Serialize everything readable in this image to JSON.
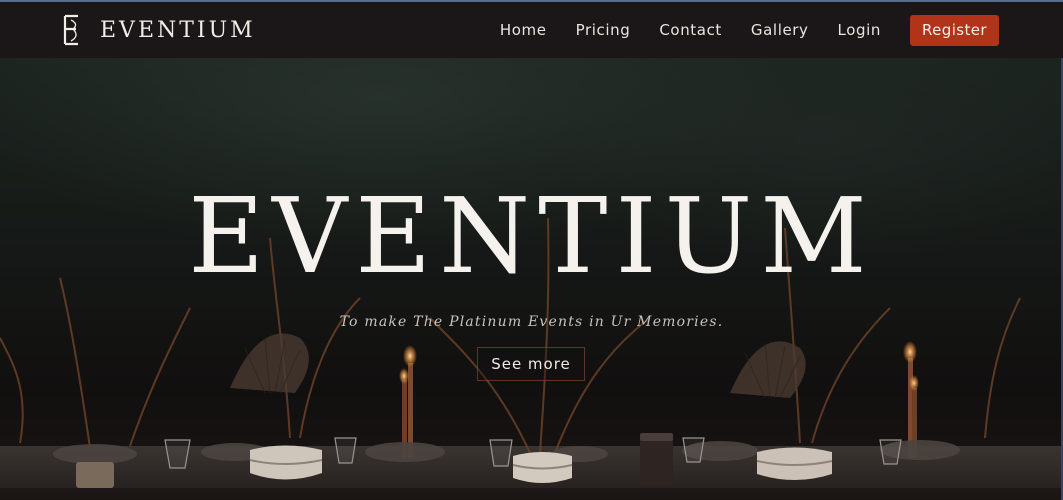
{
  "navbar": {
    "brand_name": "EVENTIUM",
    "links": [
      "Home",
      "Pricing",
      "Contact",
      "Gallery",
      "Login"
    ],
    "register_label": "Register"
  },
  "hero": {
    "title": "EVENTIUM",
    "tagline": "To make The Platinum Events in Ur Memories.",
    "cta_label": "See more"
  },
  "colors": {
    "navbar_bg": "#1b1617",
    "register_bg": "#b0331a",
    "text_light": "#f5f2ee"
  },
  "icons": [
    "eventium-logo-icon"
  ]
}
